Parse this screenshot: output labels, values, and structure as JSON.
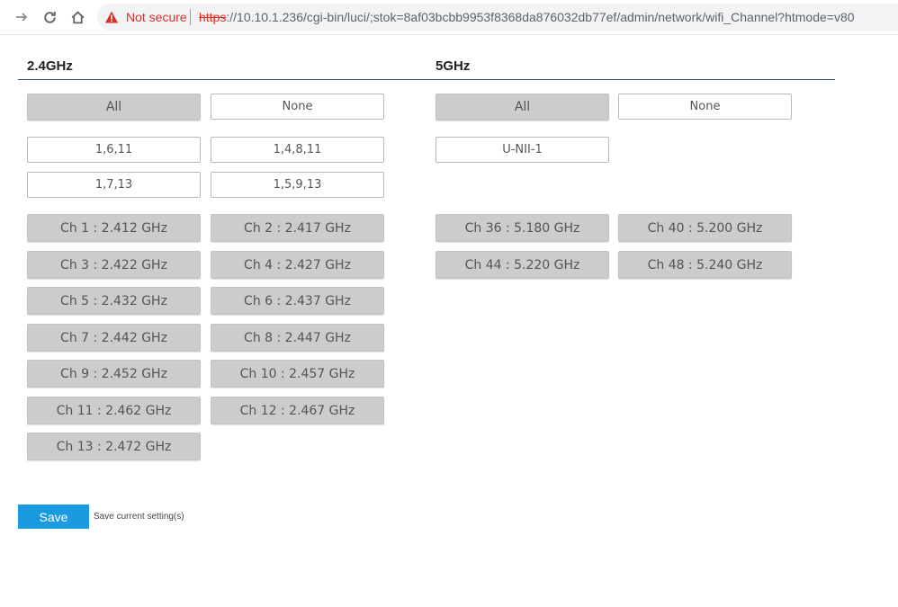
{
  "browser": {
    "security_label": "Not secure",
    "url_scheme": "https",
    "url_rest": "://10.10.1.236/cgi-bin/luci/;stok=8af03bcbb9953f8368da876032db77ef/admin/network/wifi_Channel?htmode=v80"
  },
  "band24": {
    "title": "2.4GHz",
    "all_label": "All",
    "none_label": "None",
    "presets": [
      "1,6,11",
      "1,4,8,11",
      "1,7,13",
      "1,5,9,13"
    ],
    "channels": [
      "Ch 1 : 2.412 GHz",
      "Ch 2 : 2.417 GHz",
      "Ch 3 : 2.422 GHz",
      "Ch 4 : 2.427 GHz",
      "Ch 5 : 2.432 GHz",
      "Ch 6 : 2.437 GHz",
      "Ch 7 : 2.442 GHz",
      "Ch 8 : 2.447 GHz",
      "Ch 9 : 2.452 GHz",
      "Ch 10 : 2.457 GHz",
      "Ch 11 : 2.462 GHz",
      "Ch 12 : 2.467 GHz",
      "Ch 13 : 2.472 GHz"
    ]
  },
  "band5": {
    "title": "5GHz",
    "all_label": "All",
    "none_label": "None",
    "presets": [
      "U-NII-1"
    ],
    "channels": [
      "Ch 36 : 5.180 GHz",
      "Ch 40 : 5.200 GHz",
      "Ch 44 : 5.220 GHz",
      "Ch 48 : 5.240 GHz"
    ]
  },
  "footer": {
    "save_label": "Save",
    "save_note": "Save current setting(s)"
  }
}
